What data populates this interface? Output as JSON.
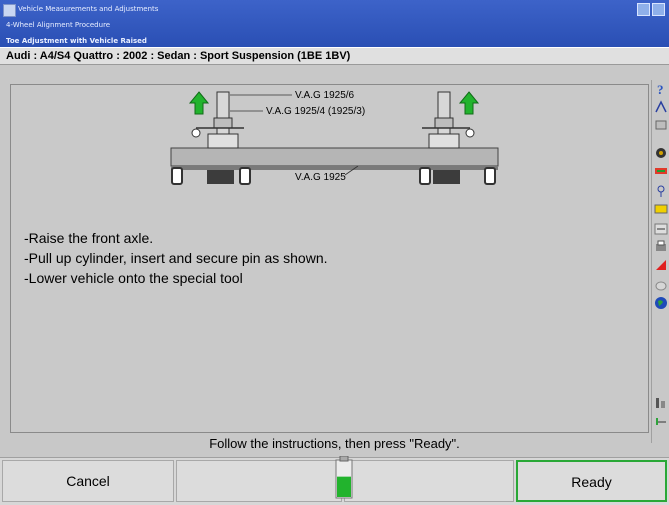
{
  "titlebar": {
    "window_title": "Vehicle Measurements and Adjustments",
    "procedure_title": "4-Wheel Alignment Procedure",
    "screen_title": "Toe Adjustment with Vehicle Raised"
  },
  "vehicle": {
    "description": "Audi : A4/S4 Quattro : 2002 : Sedan : Sport Suspension (1BE 1BV)"
  },
  "diagram": {
    "labels": [
      "V.A.G 1925/6",
      "V.A.G 1925/4  (1925/3)",
      "V.A.G 1925"
    ]
  },
  "instructions": [
    "-Raise the front axle.",
    "-Pull up cylinder, insert and secure pin as shown.",
    "-Lower vehicle onto the special tool"
  ],
  "status_text": "Follow the instructions, then press \"Ready\".",
  "buttons": {
    "cancel": "Cancel",
    "ready": "Ready"
  },
  "meter_level": 0.55,
  "icons": [
    "help-icon",
    "measure-icon",
    "specs-icon",
    "wheel-icon",
    "caster-icon",
    "tools-icon",
    "toolbar-icon",
    "adjust-icon",
    "print-icon",
    "red-pointer-icon",
    "target-icon",
    "globe-icon",
    "gauge-icon"
  ],
  "colors": {
    "title_bar": "#2a4fb4",
    "ready_border": "#29a836",
    "arrow": "#22b32d"
  }
}
